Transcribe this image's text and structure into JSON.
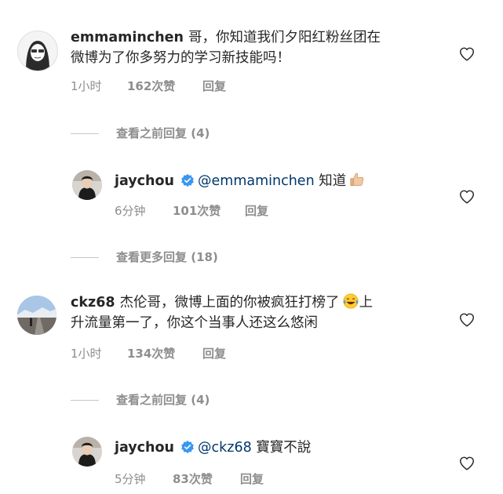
{
  "comments": [
    {
      "username": "emmaminchen",
      "line1": "哥，你知道我们夕阳红粉丝团在",
      "line2": "微博为了你多努力的学习新技能吗！",
      "time": "1小时",
      "likes": "162次赞",
      "reply": "回复",
      "view_replies": "查看之前回复 (4)"
    },
    {
      "username": "jaychou",
      "mention": "@emmaminchen",
      "text": "知道",
      "emoji": "thumbs-up-emoji",
      "time": "6分钟",
      "likes": "101次赞",
      "reply": "回复",
      "view_replies": "查看更多回复 (18)"
    },
    {
      "username": "ckz68",
      "line1": "杰伦哥，微博上面的你被疯狂打榜了",
      "line1_end": "上",
      "line2": "升流量第一了，你这个当事人还这么悠闲",
      "emoji": "tears-of-joy-emoji",
      "time": "1小时",
      "likes": "134次赞",
      "reply": "回复",
      "view_replies": "查看之前回复 (4)"
    },
    {
      "username": "jaychou",
      "mention": "@ckz68",
      "text": "寶寶不說",
      "time": "5分钟",
      "likes": "83次赞",
      "reply": "回复"
    }
  ],
  "icons": {
    "like": "heart-outline-icon",
    "verified": "verified-badge-icon"
  },
  "colors": {
    "mention": "#00376b",
    "meta": "#8e8e8e",
    "verified": "#3897f0"
  }
}
